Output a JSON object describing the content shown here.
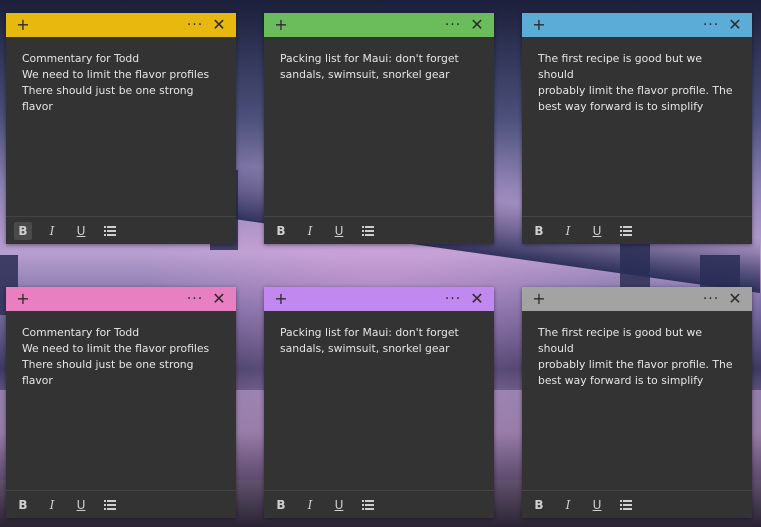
{
  "notes": [
    {
      "color": "#e7b80e",
      "text": "Commentary for Todd\nWe need to limit the flavor profiles\nThere should just be one strong flavor",
      "bold_active": true,
      "show_more": false
    },
    {
      "color": "#6bbd5c",
      "text": "Packing list for Maui: don't forget\nsandals, swimsuit, snorkel gear",
      "bold_active": false,
      "show_more": true
    },
    {
      "color": "#5bacd6",
      "text": "The first recipe is good but we should\nprobably limit the flavor profile. The\nbest way forward is to simplify",
      "bold_active": false,
      "show_more": true
    },
    {
      "color": "#e77fc0",
      "text": "Commentary for Todd\nWe need to limit the flavor profiles\nThere should just be one strong flavor",
      "bold_active": false,
      "show_more": true
    },
    {
      "color": "#c188f0",
      "text": "Packing list for Maui: don't forget\nsandals, swimsuit, snorkel gear",
      "bold_active": false,
      "show_more": true
    },
    {
      "color": "#a3a3a3",
      "text": "The first recipe is good but we should\nprobably limit the flavor profile. The\nbest way forward is to simplify",
      "bold_active": false,
      "show_more": true
    }
  ],
  "toolbar": {
    "bold": "B",
    "italic": "I",
    "underline": "U",
    "list_icon": "bullet-list-icon"
  },
  "header_icons": {
    "add": "+",
    "more": "···",
    "close": "✕"
  }
}
